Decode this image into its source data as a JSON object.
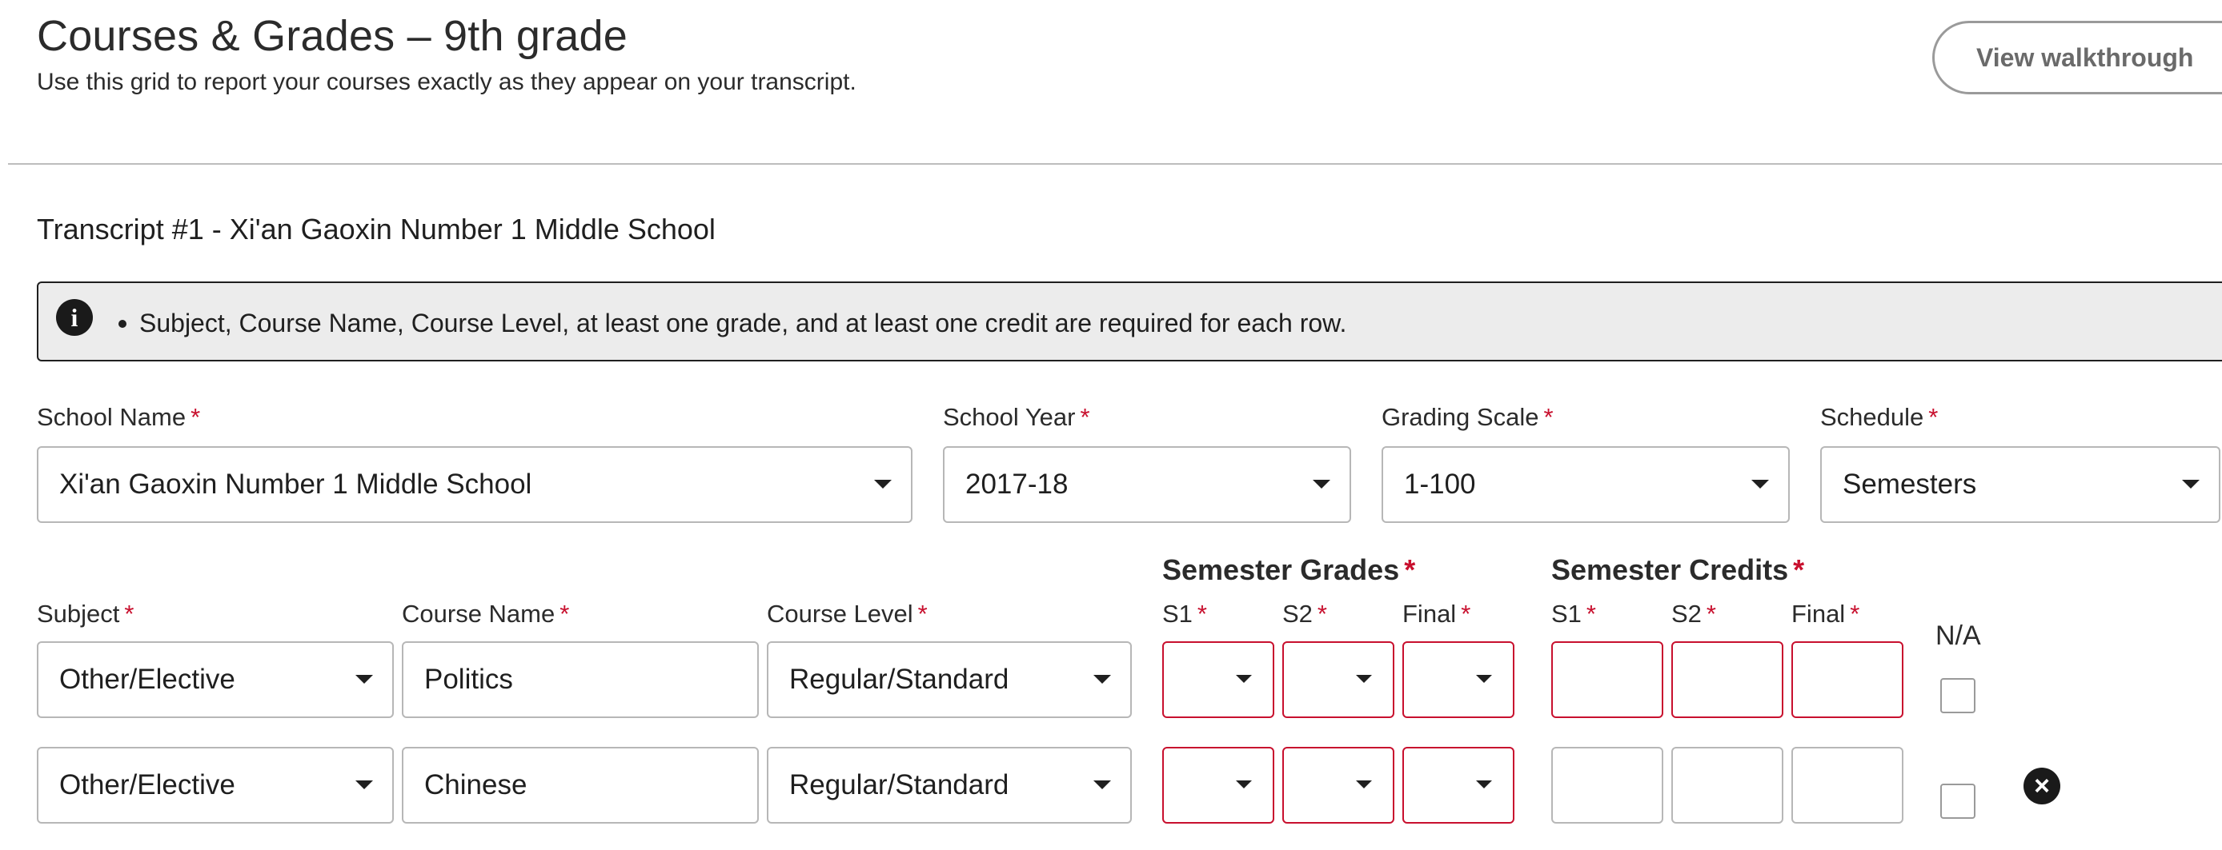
{
  "header": {
    "title": "Courses & Grades – 9th grade",
    "subtitle": "Use this grid to report your courses exactly as they appear on your transcript.",
    "walkthrough_label": "View walkthrough"
  },
  "transcript": {
    "heading": "Transcript #1 - Xi'an Gaoxin Number 1 Middle School"
  },
  "info": {
    "message": "Subject, Course Name, Course Level, at least one grade, and at least one credit are required for each row."
  },
  "school_fields": {
    "school_name": {
      "label": "School Name",
      "required": "*",
      "value": "Xi'an Gaoxin Number 1 Middle School"
    },
    "school_year": {
      "label": "School Year",
      "required": "*",
      "value": "2017-18"
    },
    "grading_scale": {
      "label": "Grading Scale",
      "required": "*",
      "value": "1-100"
    },
    "schedule": {
      "label": "Schedule",
      "required": "*",
      "value": "Semesters"
    }
  },
  "grid": {
    "headers": {
      "subject": "Subject",
      "course_name": "Course Name",
      "course_level": "Course Level",
      "semester_grades": "Semester Grades",
      "semester_credits": "Semester Credits",
      "s1": "S1",
      "s2": "S2",
      "final": "Final",
      "na": "N/A",
      "required": "*"
    },
    "rows": [
      {
        "subject": "Other/Elective",
        "course_name": "Politics",
        "course_level": "Regular/Standard"
      },
      {
        "subject": "Other/Elective",
        "course_name": "Chinese",
        "course_level": "Regular/Standard"
      }
    ]
  },
  "colors": {
    "required": "#c8102e",
    "error_border": "#c8102e",
    "banner_bg": "#ececec"
  }
}
